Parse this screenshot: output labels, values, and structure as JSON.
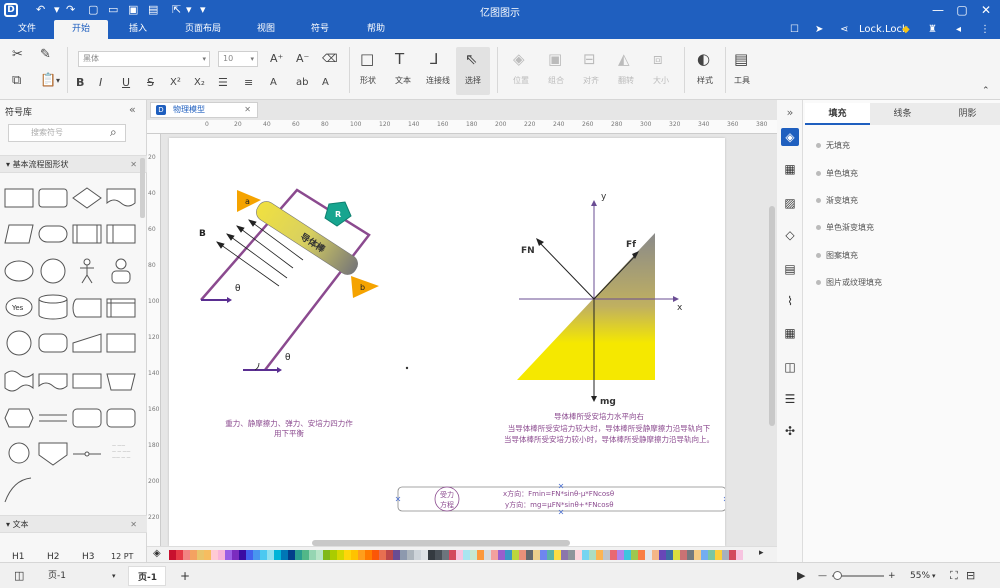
{
  "app": {
    "title": "亿图图示"
  },
  "titlebar": {
    "user": "Lock.Lock"
  },
  "menu": {
    "tabs": [
      "文件",
      "开始",
      "插入",
      "页面布局",
      "视图",
      "符号",
      "帮助"
    ],
    "active": "开始"
  },
  "ribbon": {
    "font_name": "黑体",
    "font_size": "10",
    "buttons": {
      "shape": "形状",
      "text": "文本",
      "connector": "连接线",
      "select": "选择",
      "position": "位置",
      "group": "组合",
      "align": "对齐",
      "rotate": "翻转",
      "size": "大小",
      "style": "样式",
      "tools": "工具"
    }
  },
  "left_panel": {
    "title": "符号库",
    "search_placeholder": "搜索符号",
    "section1": "基本流程图形状",
    "section2": "文本",
    "yes_label": "Yes",
    "text_samples": [
      "H1",
      "H2",
      "H3",
      "12 PT"
    ]
  },
  "document": {
    "tab": "物理模型"
  },
  "ruler_h": [
    "0",
    "20",
    "40",
    "60",
    "80",
    "100",
    "120",
    "140",
    "160",
    "180",
    "200",
    "220",
    "240",
    "260",
    "280",
    "300",
    "320",
    "340",
    "360",
    "380",
    "400"
  ],
  "ruler_v": [
    "20",
    "40",
    "60",
    "80",
    "100",
    "120",
    "140",
    "160",
    "180",
    "200",
    "220"
  ],
  "diagram1": {
    "label_a": "a",
    "label_b": "b",
    "label_R": "R",
    "label_B": "B",
    "theta1": "θ",
    "theta2": "θ",
    "rod_text": "导体棒",
    "caption_line1": "重力、静摩擦力、弹力、安培力四力作",
    "caption_line2": "用下平衡"
  },
  "diagram2": {
    "axis_y": "y",
    "axis_x": "x",
    "label_FN": "FN",
    "label_Ff": "Ff",
    "label_mg": "mg",
    "caption": [
      "导体棒所受安培力水平向右",
      "当导体棒所受安培力较大时，导体棒所受静摩擦力沿导轨向下",
      "当导体棒所受安培力较小时，导体棒所受静摩擦力沿导轨向上。"
    ]
  },
  "equation": {
    "circle_label_1": "受力",
    "circle_label_2": "方程",
    "line1": "x方向：Fmin=FN*sinθ-μ*FNcosθ",
    "line2": "y方向：mg=μFN*sinθ+*FNcosθ"
  },
  "right_panel": {
    "tabs": [
      "填充",
      "线条",
      "阴影"
    ],
    "fill_options": [
      "无填充",
      "单色填充",
      "渐变填充",
      "单色渐变填充",
      "图案填充",
      "图片或纹理填充"
    ]
  },
  "status": {
    "page_dropdown": "页-1",
    "page_tab": "页-1",
    "zoom": "55%"
  },
  "colors": {
    "accent": "#1f5fbf",
    "rail": "#8b4a8f",
    "arrow": "#5a2e91",
    "triangle_top": "#8a8a8a",
    "triangle_bottom": "#f5e800",
    "label_bg": "#f5a300",
    "resistor": "#17a58f",
    "palette": [
      "#c8102e",
      "#e63946",
      "#f28482",
      "#f4a261",
      "#e9c46a",
      "#f6bd60",
      "#ffcad4",
      "#f8b4d9",
      "#9b5de5",
      "#7b2cbf",
      "#3a0ca3",
      "#4361ee",
      "#4895ef",
      "#4cc9f0",
      "#90e0ef",
      "#00b4d8",
      "#0077b6",
      "#023e8a",
      "#2a9d8f",
      "#52b788",
      "#95d5b2",
      "#b7e4c7",
      "#80b918",
      "#aacc00",
      "#d4d700",
      "#ffd60a",
      "#ffc300",
      "#ff9f1c",
      "#ff7b00",
      "#fb5607",
      "#e76f51",
      "#bc4749",
      "#6a4c93",
      "#8d99ae",
      "#adb5bd",
      "#ced4da",
      "#dee2e6",
      "#343a40",
      "#495057",
      "#6c757d"
    ]
  }
}
